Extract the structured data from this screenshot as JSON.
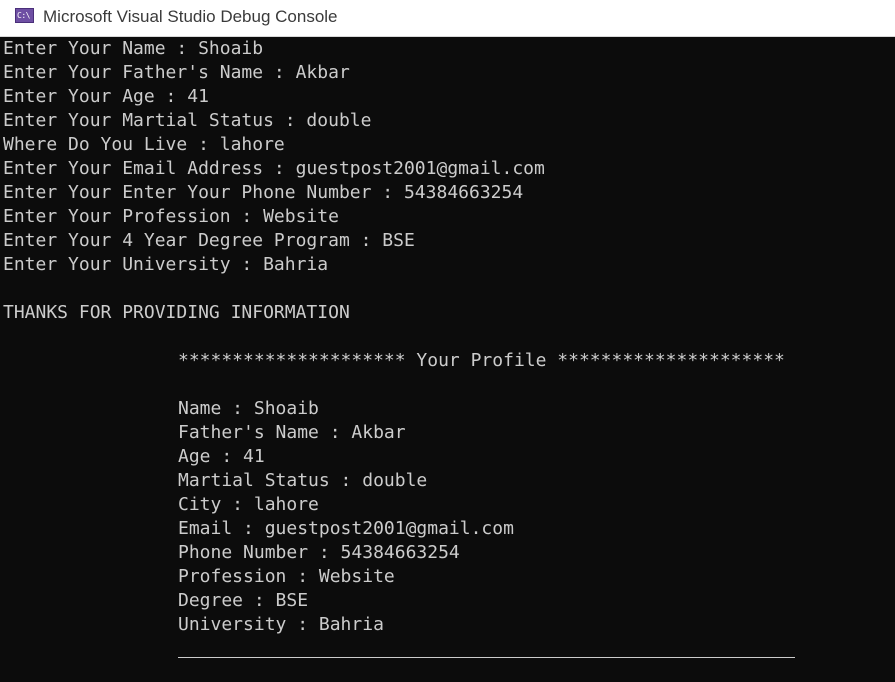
{
  "window": {
    "title": "Microsoft Visual Studio Debug Console",
    "icon_text": "C:\\",
    "icon": "console-app-icon"
  },
  "colors": {
    "console_bg": "#0c0c0c",
    "console_text": "#cccccc",
    "titlebar_bg": "#ffffff",
    "icon_bg": "#6e4fa3"
  },
  "console": {
    "input_lines": [
      "Enter Your Name : Shoaib",
      "Enter Your Father's Name : Akbar",
      "Enter Your Age : 41",
      "Enter Your Martial Status : double",
      "Where Do You Live : lahore",
      "Enter Your Email Address : guestpost2001@gmail.com",
      "Enter Your Enter Your Phone Number : 54384663254",
      "Enter Your Profession : Website",
      "Enter Your 4 Year Degree Program : BSE",
      "Enter Your University : Bahria"
    ],
    "thanks": "THANKS FOR PROVIDING INFORMATION",
    "profile_header": "********************* Your Profile *********************",
    "profile_lines": [
      "Name : Shoaib",
      "Father's Name : Akbar",
      "Age : 41",
      "Martial Status : double",
      "City : lahore",
      "Email : guestpost2001@gmail.com",
      "Phone Number : 54384663254",
      "Profession : Website",
      "Degree : BSE",
      "University : Bahria"
    ]
  }
}
